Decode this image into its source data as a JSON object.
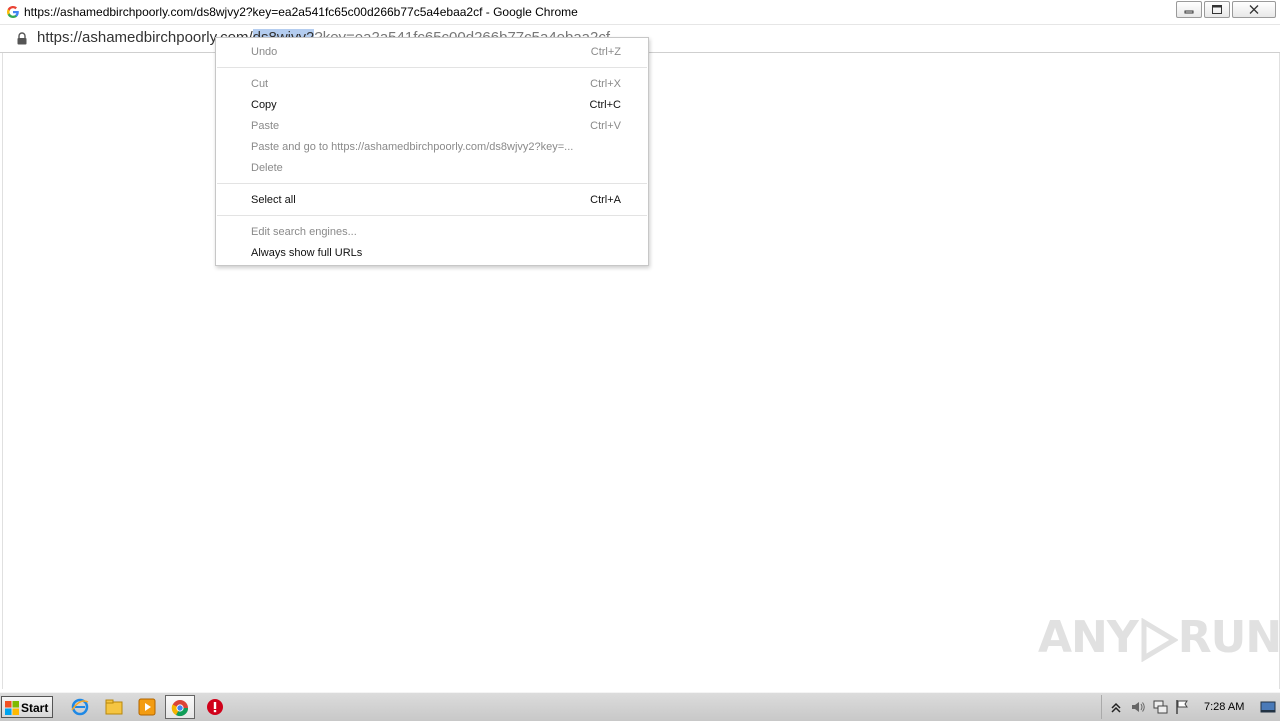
{
  "window": {
    "title": "https://ashamedbirchpoorly.com/ds8wjvy2?key=ea2a541fc65c00d266b77c5a4ebaa2cf - Google Chrome"
  },
  "omnibox": {
    "url_prefix": "https://ashamedbirchpoorly.com/",
    "url_selected": "ds8wjvy2",
    "url_rest": "?key=ea2a541fc65c00d266b77c5a4ebaa2cf"
  },
  "context_menu": {
    "items": [
      {
        "label": "Undo",
        "shortcut": "Ctrl+Z",
        "enabled": false
      },
      {
        "label": "Cut",
        "shortcut": "Ctrl+X",
        "enabled": false
      },
      {
        "label": "Copy",
        "shortcut": "Ctrl+C",
        "enabled": true
      },
      {
        "label": "Paste",
        "shortcut": "Ctrl+V",
        "enabled": false
      },
      {
        "label": "Paste and go to https://ashamedbirchpoorly.com/ds8wjvy2?key=...",
        "shortcut": "",
        "enabled": false
      },
      {
        "label": "Delete",
        "shortcut": "",
        "enabled": false
      },
      {
        "label": "Select all",
        "shortcut": "Ctrl+A",
        "enabled": true
      },
      {
        "label": "Edit search engines...",
        "shortcut": "",
        "enabled": false
      },
      {
        "label": "Always show full URLs",
        "shortcut": "",
        "enabled": true
      }
    ]
  },
  "watermark": {
    "left": "ANY",
    "right": "RUN"
  },
  "taskbar": {
    "start_label": "Start",
    "clock": "7:28 AM"
  },
  "colors": {
    "selection": "#b4cdf0",
    "disabled_text": "#8a8a8a",
    "taskbar": "#d4d4d4"
  }
}
